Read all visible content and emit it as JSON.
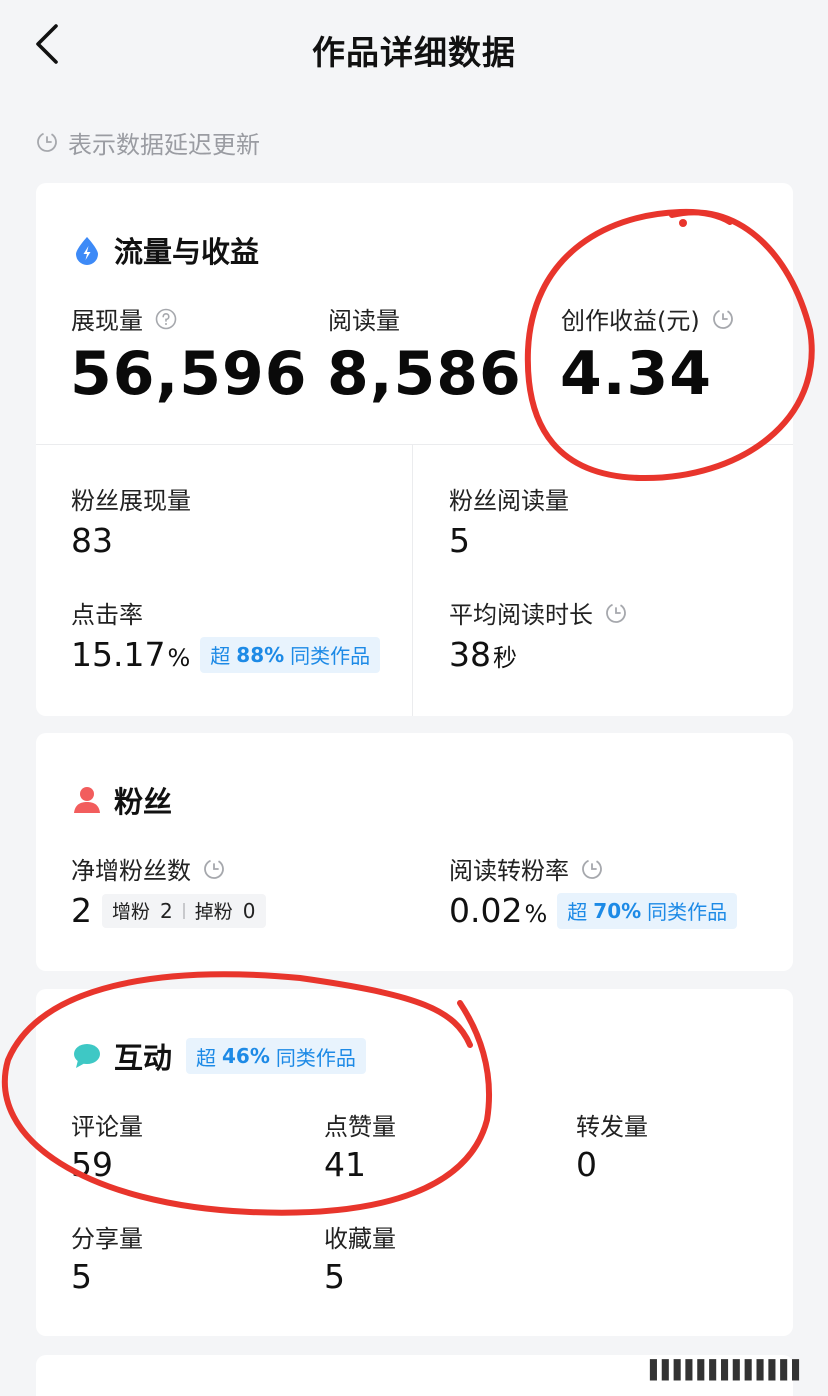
{
  "header": {
    "title": "作品详细数据",
    "back_icon": "chevron-left-icon"
  },
  "notice": {
    "text": "表示数据延迟更新",
    "icon": "clock-icon"
  },
  "traffic": {
    "title": "流量与收益",
    "icon_color": "#3d8af7",
    "impressions": {
      "label": "展现量",
      "value": "56,596"
    },
    "reads": {
      "label": "阅读量",
      "value": "8,586"
    },
    "earnings": {
      "label": "创作收益(元)",
      "value": "4.34"
    },
    "fan_impressions": {
      "label": "粉丝展现量",
      "value": "83"
    },
    "fan_reads": {
      "label": "粉丝阅读量",
      "value": "5"
    },
    "ctr": {
      "label": "点击率",
      "value": "15.17",
      "unit": "%",
      "badge_pre": "超",
      "badge_pct": "88%",
      "badge_post": "同类作品"
    },
    "avg_time": {
      "label": "平均阅读时长",
      "value": "38",
      "unit": "秒"
    }
  },
  "fans": {
    "title": "粉丝",
    "icon_color": "#f25d5d",
    "net_gain": {
      "label": "净增粉丝数",
      "value": "2",
      "gain_label": "增粉",
      "gain": "2",
      "loss_label": "掉粉",
      "loss": "0"
    },
    "conversion": {
      "label": "阅读转粉率",
      "value": "0.02",
      "unit": "%",
      "badge_pre": "超",
      "badge_pct": "70%",
      "badge_post": "同类作品"
    }
  },
  "interaction": {
    "title": "互动",
    "icon_color": "#3ec8c5",
    "badge_pre": "超",
    "badge_pct": "46%",
    "badge_post": "同类作品",
    "comments": {
      "label": "评论量",
      "value": "59"
    },
    "likes": {
      "label": "点赞量",
      "value": "41"
    },
    "reposts": {
      "label": "转发量",
      "value": "0"
    },
    "shares": {
      "label": "分享量",
      "value": "5"
    },
    "favorites": {
      "label": "收藏量",
      "value": "5"
    }
  },
  "colors": {
    "accent": "#1d8ae6",
    "annotation": "#e8352c",
    "background": "#f4f5f7"
  }
}
